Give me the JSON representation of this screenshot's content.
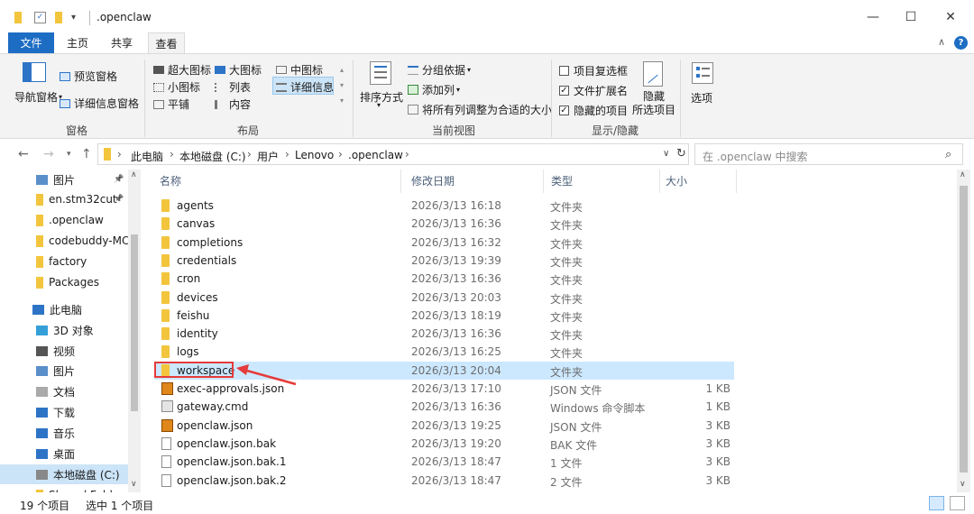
{
  "window": {
    "title": ".openclaw",
    "minimize": "—",
    "maximize": "☐",
    "close": "✕"
  },
  "ribbon_tabs": [
    "文件",
    "主页",
    "共享",
    "查看"
  ],
  "ribbon": {
    "panes": {
      "nav_pane": "导航窗格",
      "preview_pane": "预览窗格",
      "details_pane": "详细信息窗格",
      "label": "窗格"
    },
    "layout": {
      "items": [
        "超大图标",
        "大图标",
        "中图标",
        "小图标",
        "列表",
        "详细信息",
        "平铺",
        "内容"
      ],
      "label": "布局"
    },
    "current_view": {
      "sort": "排序方式",
      "group_by": "分组依据",
      "add_column": "添加列",
      "size_all_columns": "将所有列调整为合适的大小",
      "label": "当前视图"
    },
    "show_hide": {
      "item_checkboxes": "项目复选框",
      "file_extensions": "文件扩展名",
      "hidden_items": "隐藏的项目",
      "hide_selected_line1": "隐藏",
      "hide_selected_line2": "所选项目",
      "label": "显示/隐藏"
    },
    "options": "选项"
  },
  "address": {
    "crumbs": [
      "此电脑",
      "本地磁盘 (C:)",
      "用户",
      "Lenovo",
      ".openclaw"
    ],
    "search_placeholder": "在 .openclaw 中搜索"
  },
  "nav_pane": {
    "items": [
      {
        "label": "图片",
        "icon": "pictures-icon",
        "pinned": true
      },
      {
        "label": "en.stm32cut",
        "icon": "folder-icon",
        "pinned": true
      },
      {
        "label": ".openclaw",
        "icon": "folder-icon"
      },
      {
        "label": "codebuddy-MC",
        "icon": "folder-icon"
      },
      {
        "label": "factory",
        "icon": "folder-icon"
      },
      {
        "label": "Packages",
        "icon": "folder-icon"
      },
      {
        "label": "此电脑",
        "icon": "this-pc-icon"
      },
      {
        "label": "3D 对象",
        "icon": "3d-objects-icon"
      },
      {
        "label": "视频",
        "icon": "videos-icon"
      },
      {
        "label": "图片",
        "icon": "pictures-icon"
      },
      {
        "label": "文档",
        "icon": "documents-icon"
      },
      {
        "label": "下载",
        "icon": "downloads-icon"
      },
      {
        "label": "音乐",
        "icon": "music-icon"
      },
      {
        "label": "桌面",
        "icon": "desktop-icon"
      },
      {
        "label": "本地磁盘 (C:)",
        "icon": "drive-icon",
        "selected": true
      },
      {
        "label": "Shared Folders",
        "icon": "folder-icon"
      }
    ]
  },
  "list": {
    "columns": [
      "名称",
      "修改日期",
      "类型",
      "大小"
    ],
    "rows": [
      {
        "name": "agents",
        "date": "2026/3/13 16:18",
        "type": "文件夹",
        "size": "",
        "icon": "folder-icon"
      },
      {
        "name": "canvas",
        "date": "2026/3/13 16:36",
        "type": "文件夹",
        "size": "",
        "icon": "folder-icon"
      },
      {
        "name": "completions",
        "date": "2026/3/13 16:32",
        "type": "文件夹",
        "size": "",
        "icon": "folder-icon"
      },
      {
        "name": "credentials",
        "date": "2026/3/13 19:39",
        "type": "文件夹",
        "size": "",
        "icon": "folder-icon"
      },
      {
        "name": "cron",
        "date": "2026/3/13 16:36",
        "type": "文件夹",
        "size": "",
        "icon": "folder-icon"
      },
      {
        "name": "devices",
        "date": "2026/3/13 20:03",
        "type": "文件夹",
        "size": "",
        "icon": "folder-icon"
      },
      {
        "name": "feishu",
        "date": "2026/3/13 18:19",
        "type": "文件夹",
        "size": "",
        "icon": "folder-icon"
      },
      {
        "name": "identity",
        "date": "2026/3/13 16:36",
        "type": "文件夹",
        "size": "",
        "icon": "folder-icon"
      },
      {
        "name": "logs",
        "date": "2026/3/13 16:25",
        "type": "文件夹",
        "size": "",
        "icon": "folder-icon"
      },
      {
        "name": "workspace",
        "date": "2026/3/13 20:04",
        "type": "文件夹",
        "size": "",
        "icon": "folder-icon",
        "selected": true
      },
      {
        "name": "exec-approvals.json",
        "date": "2026/3/13 17:10",
        "type": "JSON 文件",
        "size": "1 KB",
        "icon": "json-file-icon"
      },
      {
        "name": "gateway.cmd",
        "date": "2026/3/13 16:36",
        "type": "Windows 命令脚本",
        "size": "1 KB",
        "icon": "cmd-file-icon"
      },
      {
        "name": "openclaw.json",
        "date": "2026/3/13 19:25",
        "type": "JSON 文件",
        "size": "3 KB",
        "icon": "json-file-icon"
      },
      {
        "name": "openclaw.json.bak",
        "date": "2026/3/13 19:20",
        "type": "BAK 文件",
        "size": "3 KB",
        "icon": "file-icon"
      },
      {
        "name": "openclaw.json.bak.1",
        "date": "2026/3/13 18:47",
        "type": "1 文件",
        "size": "3 KB",
        "icon": "file-icon"
      },
      {
        "name": "openclaw.json.bak.2",
        "date": "2026/3/13 18:47",
        "type": "2 文件",
        "size": "3 KB",
        "icon": "file-icon"
      }
    ]
  },
  "status": {
    "item_count": "19 个项目",
    "selected_count": "选中 1 个项目"
  },
  "colors": {
    "accent": "#1e6dc4",
    "selection": "#cce8ff",
    "annotation": "#e53b3b"
  }
}
